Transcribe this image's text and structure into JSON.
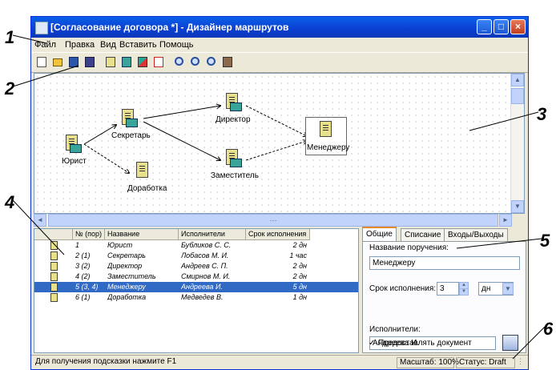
{
  "callouts": [
    "1",
    "2",
    "3",
    "4",
    "5",
    "6"
  ],
  "window": {
    "title": "[Согласование договора *] - Дизайнер маршрутов",
    "minimize": "_",
    "maximize": "□",
    "close": "×"
  },
  "menu": [
    "Файл",
    "Правка",
    "Вид",
    "Вставить",
    "Помощь"
  ],
  "toolbar_icons": [
    "new-icon",
    "open-icon",
    "save-icon",
    "dark-icon",
    "stage-icon",
    "route-icon",
    "magic-icon",
    "delete-icon",
    "zoom-in-icon",
    "zoom-out-icon",
    "zoom-fit-icon",
    "settings-icon"
  ],
  "nodes": [
    {
      "label": "Юрист"
    },
    {
      "label": "Секретарь"
    },
    {
      "label": "Доработка"
    },
    {
      "label": "Директор"
    },
    {
      "label": "Заместитель"
    },
    {
      "label": "Менеджеру"
    }
  ],
  "grid": {
    "columns": [
      "№ (пор)",
      "Название",
      "Исполнители",
      "Срок исполнения"
    ],
    "rows": [
      {
        "num": "1",
        "name": "Юрист",
        "executor": "Бубликов С. С.",
        "term": "2 дн"
      },
      {
        "num": "2 (1)",
        "name": "Секретарь",
        "executor": "Лобасов М. И.",
        "term": "1 час"
      },
      {
        "num": "3 (2)",
        "name": "Директор",
        "executor": "Андреев С. П.",
        "term": "2 дн"
      },
      {
        "num": "4 (2)",
        "name": "Заместитель",
        "executor": "Смирнов М. И.",
        "term": "2 дн"
      },
      {
        "num": "5 (3, 4)",
        "name": "Менеджеру",
        "executor": "Андреева И.",
        "term": "5 дн"
      },
      {
        "num": "6 (1)",
        "name": "Доработка",
        "executor": "Медведев В.",
        "term": "1 дн"
      }
    ],
    "selected_row": 4
  },
  "panel": {
    "tabs": [
      "Общие",
      "Списание",
      "Входы/Выходы"
    ],
    "name_label": "Название поручения:",
    "name_value": "Менеджеру",
    "term_label": "Срок исполнения:",
    "term_value": "3",
    "term_unit": "дн",
    "executor_label": "Исполнители:",
    "executor_value": "Андреева И.",
    "check_label": "Предоставлять документ",
    "check_mark": "✓"
  },
  "status": {
    "hint": "Для получения подсказки нажмите F1",
    "zoom": "Масштаб: 100%",
    "state": "Статус: Draft"
  },
  "glyphs": {
    "up": "▲",
    "down": "▼",
    "left": "◄",
    "right": "►",
    "dropdown": "▼",
    "spin_up": "▲",
    "spin_down": "▼",
    "grip": "⋮",
    "hgrip": "⋯"
  }
}
